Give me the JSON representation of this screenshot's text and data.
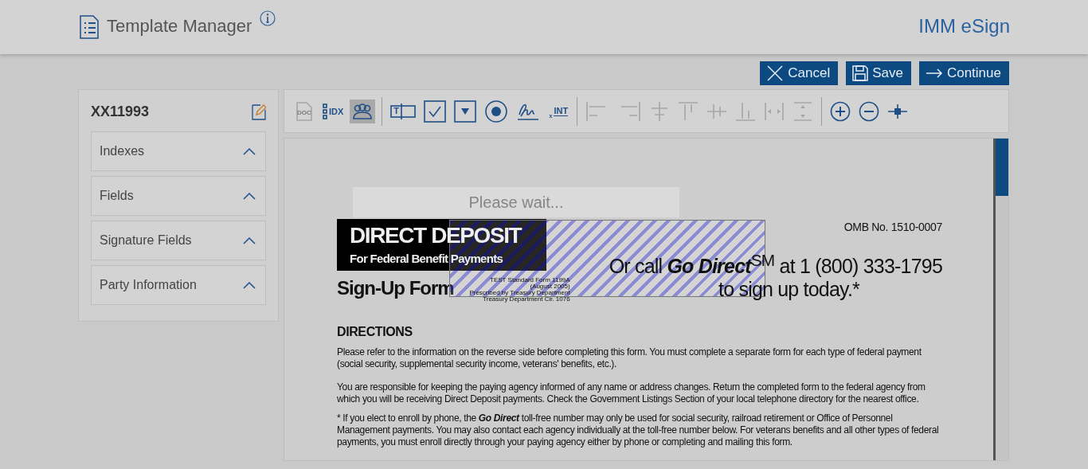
{
  "header": {
    "title": "Template Manager",
    "app_name": "IMM eSign"
  },
  "actions": [
    {
      "kind": "cancel",
      "label": "Cancel"
    },
    {
      "kind": "save",
      "label": "Save"
    },
    {
      "kind": "continue",
      "label": "Continue"
    }
  ],
  "sidebar": {
    "template_id": "XX11993",
    "sections": [
      {
        "label": "Indexes",
        "expanded": true
      },
      {
        "label": "Fields",
        "expanded": true
      },
      {
        "label": "Signature Fields",
        "expanded": true
      },
      {
        "label": "Party Information",
        "expanded": true
      }
    ]
  },
  "toolbar": [
    {
      "kind": "doc",
      "label": "DOC",
      "disabled": true,
      "selected": false
    },
    {
      "kind": "idx",
      "label": "IDX",
      "disabled": false,
      "selected": false
    },
    {
      "kind": "party",
      "disabled": false,
      "selected": true
    },
    {
      "kind": "separator"
    },
    {
      "kind": "textfield",
      "label": "T",
      "disabled": false,
      "selected": false
    },
    {
      "kind": "checkbox",
      "disabled": false,
      "selected": false
    },
    {
      "kind": "dropdown",
      "disabled": false,
      "selected": false
    },
    {
      "kind": "radio",
      "disabled": false,
      "selected": false
    },
    {
      "kind": "signature",
      "disabled": false,
      "selected": false
    },
    {
      "kind": "initials",
      "mark": "x",
      "label": "INT",
      "disabled": false,
      "selected": false
    },
    {
      "kind": "separator"
    },
    {
      "kind": "align-left",
      "disabled": true,
      "selected": false
    },
    {
      "kind": "align-right",
      "disabled": true,
      "selected": false
    },
    {
      "kind": "align-center",
      "disabled": true,
      "selected": false
    },
    {
      "kind": "align-top",
      "disabled": true,
      "selected": false
    },
    {
      "kind": "align-middle",
      "disabled": true,
      "selected": false
    },
    {
      "kind": "align-bottom",
      "disabled": true,
      "selected": false
    },
    {
      "kind": "space-horizontal",
      "disabled": true,
      "selected": false
    },
    {
      "kind": "space-vertical",
      "disabled": true,
      "selected": false
    },
    {
      "kind": "separator"
    },
    {
      "kind": "zoom-in",
      "disabled": false,
      "selected": false
    },
    {
      "kind": "zoom-out",
      "disabled": false,
      "selected": false
    },
    {
      "kind": "move",
      "disabled": false,
      "selected": false
    }
  ],
  "document": {
    "banner_title": "DIRECT DEPOSIT",
    "banner_subtitle": "For Federal Benefit Payments",
    "form_name": "Sign-Up Form",
    "form_info": [
      "TEST Standard Form 1199A",
      "(August 2005)",
      "Prescribed by Treasury Department",
      "Treasury Department Cir. 1076"
    ],
    "omb": "OMB No. 1510-0007",
    "call_line": "Or call **Go Direct**$^{SM}$ at 1 (800) 333-1795",
    "call_line_2": "to sign up today.*",
    "directions_heading": "DIRECTIONS",
    "paragraphs": [
      "Please refer to the information on the reverse side before completing this form. You must complete a separate form for each type of federal payment (social security, supplemental security income, veterans' benefits, etc.).",
      "You are responsible for keeping the paying agency informed of any name or address changes. Return the completed form to the federal agency from which you will be receiving Direct Deposit payments. Check the Government Listings Section of your local telephone directory for the nearest office.",
      "* If you elect to enroll by phone, the **Go Direct** toll-free number may only be used for social security, railroad retirement or Office of Personnel Management payments. You may also contact each agency individually at the toll-free number below. For veterans benefits and all other types of federal payments, you must enroll directly through your paying agency either by phone or completing and mailing this form."
    ]
  },
  "loading": {
    "message": "Please wait..."
  }
}
